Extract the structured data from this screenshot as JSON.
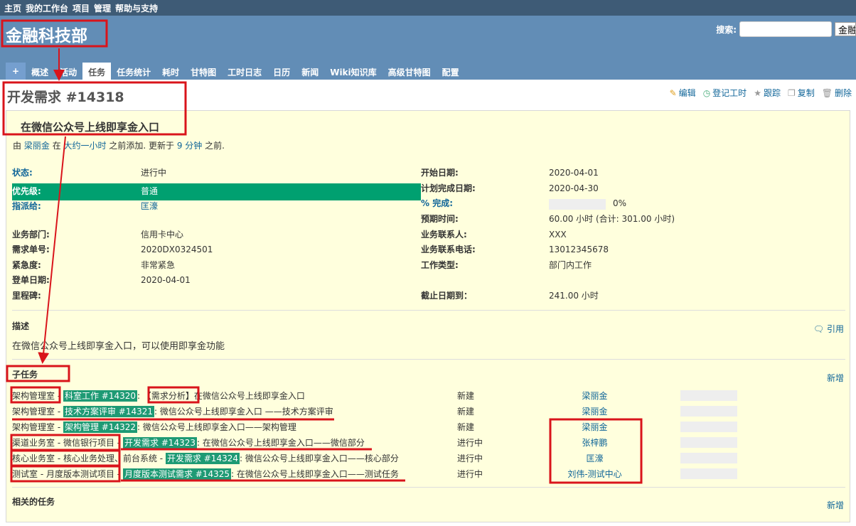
{
  "top_menu": [
    "主页",
    "我的工作台",
    "项目",
    "管理",
    "帮助与支持"
  ],
  "header": {
    "project_title": "金融科技部",
    "search_label": "搜索:",
    "search_value": "",
    "project_select": "金融科技部"
  },
  "tabs": [
    {
      "label": "+"
    },
    {
      "label": "概述"
    },
    {
      "label": "活动"
    },
    {
      "label": "任务",
      "active": true
    },
    {
      "label": "任务统计"
    },
    {
      "label": "耗时"
    },
    {
      "label": "甘特图"
    },
    {
      "label": "工时日志"
    },
    {
      "label": "日历"
    },
    {
      "label": "新闻"
    },
    {
      "label": "Wiki知识库"
    },
    {
      "label": "高级甘特图"
    },
    {
      "label": "配置"
    }
  ],
  "issue": {
    "title": "开发需求 #14318",
    "subject": "在微信公众号上线即享金入口",
    "author": {
      "by": "由",
      "name": "梁丽金",
      "at": "在",
      "added": "大约一小时",
      "added_suffix": "之前添加. 更新于",
      "updated": "9 分钟",
      "updated_suffix": "之前."
    },
    "actions": [
      {
        "label": "编辑",
        "icon": "pencil-icon"
      },
      {
        "label": "登记工时",
        "icon": "clock-add-icon"
      },
      {
        "label": "跟踪",
        "icon": "star-icon"
      },
      {
        "label": "复制",
        "icon": "copy-icon"
      },
      {
        "label": "删除",
        "icon": "trash-icon"
      }
    ],
    "left_attrs": [
      {
        "label": "状态:",
        "value": "进行中",
        "link_label": true
      },
      {
        "label": "优先级:",
        "value": "普通",
        "link_label": true
      },
      {
        "label": "指派给:",
        "value": "匡濠",
        "link_label": true,
        "link_value": true
      },
      {
        "label": "业务部门:",
        "value": "信用卡中心"
      },
      {
        "label": "需求单号:",
        "value": "2020DX0324501"
      },
      {
        "label": "紧急度:",
        "value": "非常紧急"
      },
      {
        "label": "登单日期:",
        "value": "2020-04-01"
      },
      {
        "label": "里程碑:",
        "value": ""
      }
    ],
    "right_attrs": [
      {
        "label": "开始日期:",
        "value": "2020-04-01"
      },
      {
        "label": "计划完成日期:",
        "value": "2020-04-30"
      },
      {
        "label": "% 完成:",
        "value": "0%",
        "progress": 0
      },
      {
        "label": "预期时间:",
        "value": "60.00 小时 (合计: 301.00 小时)"
      },
      {
        "label": "业务联系人:",
        "value": "XXX"
      },
      {
        "label": "业务联系电话:",
        "value": "13012345678"
      },
      {
        "label": "工作类型:",
        "value": "部门内工作"
      },
      {
        "label": "截止日期到：",
        "value": "241.00 小时"
      }
    ],
    "priority_color": "#00a070",
    "description": {
      "heading": "描述",
      "quote": "引用",
      "text": "在微信公众号上线即享金入口，可以使用即享金功能"
    },
    "subtasks": {
      "heading": "子任务",
      "add": "新增",
      "rows": [
        {
          "project": "架构管理室",
          "tracker": "科室工作 #14320",
          "subject": "【需求分析】在微信公众号上线即享金入口",
          "status": "新建",
          "assignee": "梁丽金",
          "progress": 0
        },
        {
          "project": "架构管理室",
          "tracker": "技术方案评审 #14321",
          "subject": "微信公众号上线即享金入口 ——技术方案评审",
          "status": "新建",
          "assignee": "梁丽金",
          "progress": 0
        },
        {
          "project": "架构管理室",
          "tracker": "架构管理 #14322",
          "subject": "微信公众号上线即享金入口——架构管理",
          "status": "新建",
          "assignee": "梁丽金",
          "progress": 0
        },
        {
          "project": "渠道业务室 - 微信银行项目",
          "tracker": "开发需求 #14323",
          "subject": "在微信公众号上线即享金入口——微信部分",
          "status": "进行中",
          "assignee": "张梓鹏",
          "progress": 0
        },
        {
          "project": "核心业务室 - 核心业务处理、前台系统",
          "tracker": "开发需求 #14324",
          "subject": "微信公众号上线即享金入口——核心部分",
          "status": "进行中",
          "assignee": "匡濠",
          "progress": 0
        },
        {
          "project": "测试室 - 月度版本测试项目",
          "tracker": "月度版本测试需求 #14325",
          "subject": "在微信公众号上线即享金入口——测试任务",
          "status": "进行中",
          "assignee": "刘伟-测试中心",
          "progress": 0
        }
      ]
    },
    "related": {
      "heading": "相关的任务",
      "add": "新增"
    }
  },
  "annotation_color": "#d9141b"
}
